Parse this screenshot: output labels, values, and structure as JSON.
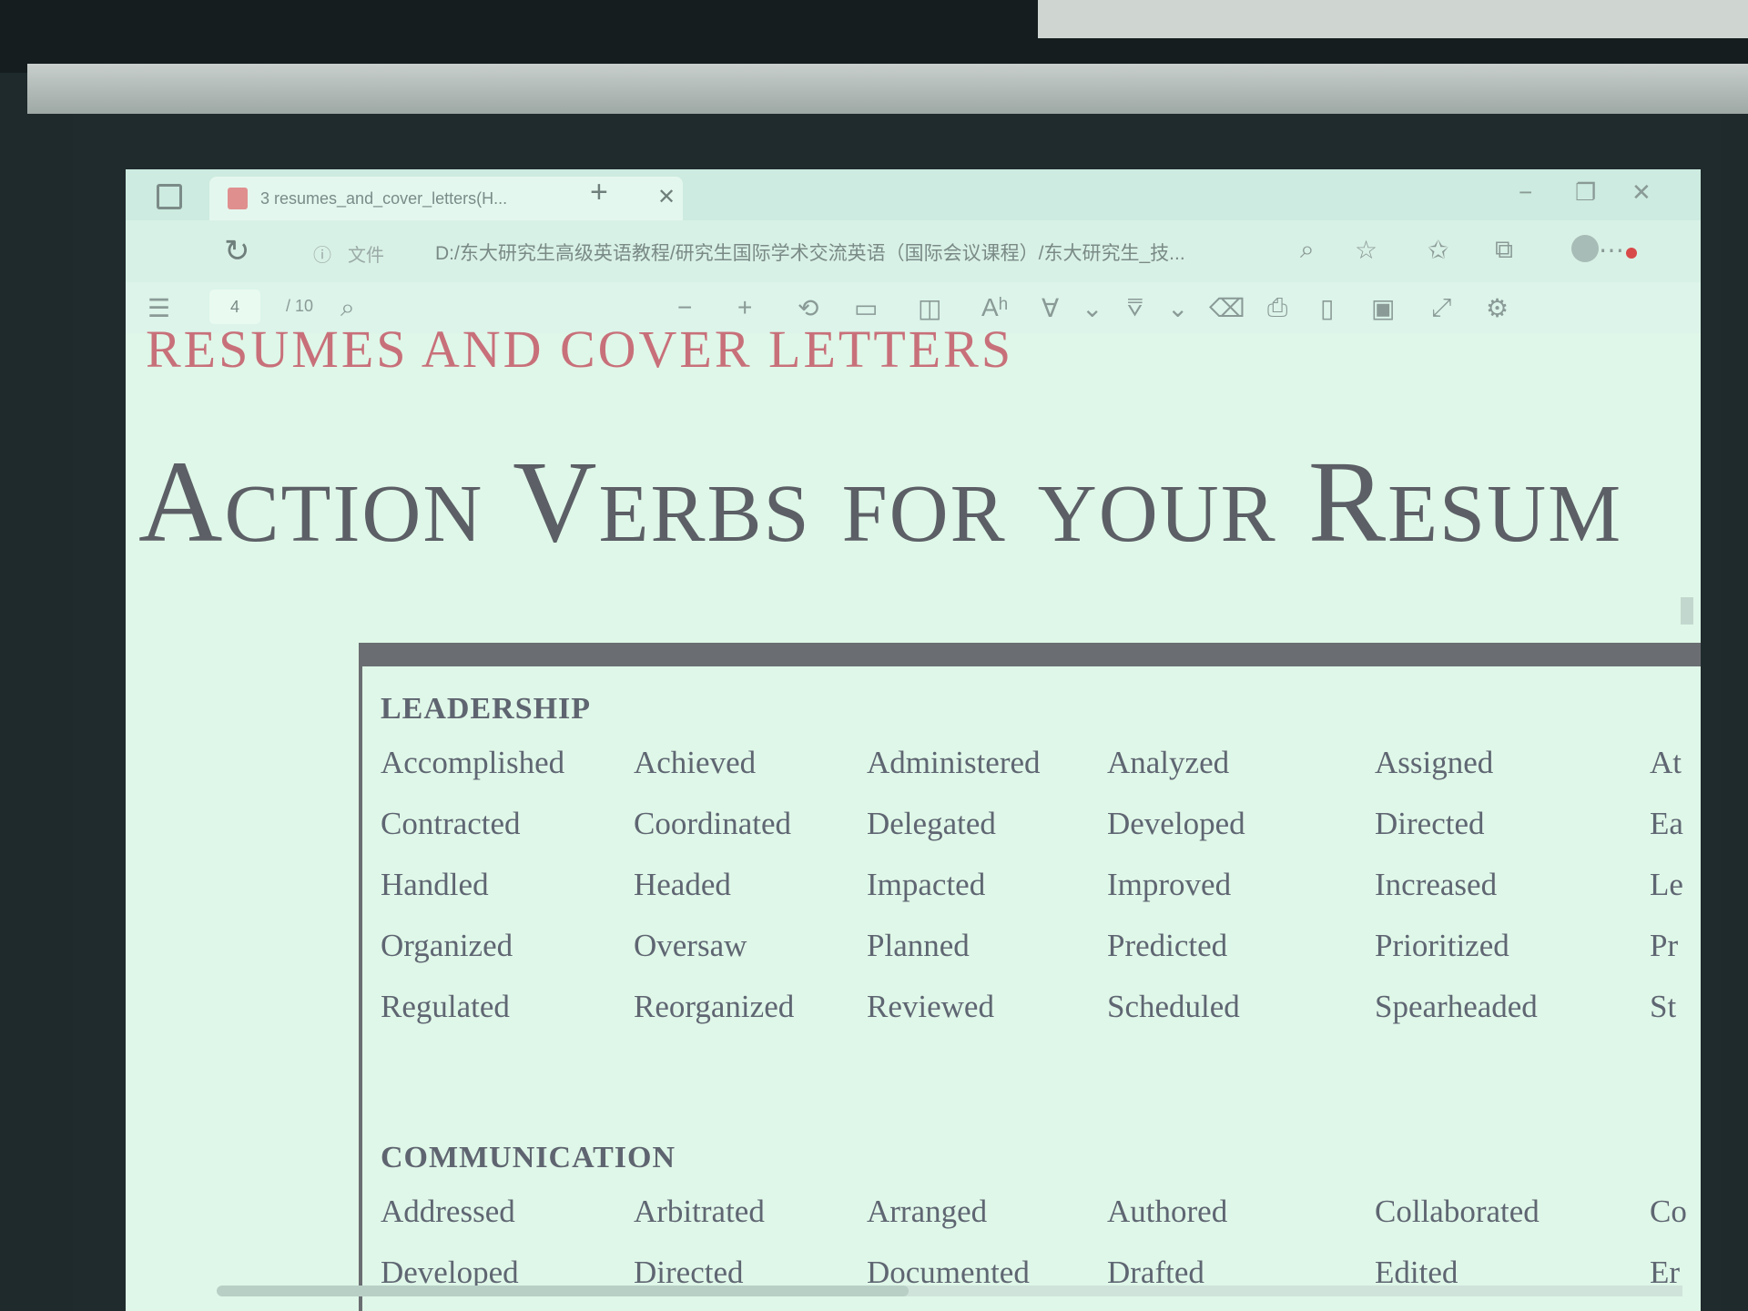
{
  "tab": {
    "title": "3 resumes_and_cover_letters(H...",
    "close_icon": "close-icon",
    "new_tab_icon": "plus-icon"
  },
  "window_controls": {
    "minimize": "−",
    "restore": "❐",
    "close": "✕"
  },
  "address": {
    "info_label": "文件",
    "url": "D:/东大研究生高级英语教程/研究生国际学术交流英语（国际会议课程）/东大研究生_技..."
  },
  "pdf_toolbar": {
    "page_current": "4",
    "page_total": "/ 10"
  },
  "document": {
    "header": "RESUMES AND COVER LETTERS",
    "title": "Action Verbs for your Resum",
    "sections": [
      {
        "heading": "LEADERSHIP",
        "rows": [
          [
            "Accomplished",
            "Achieved",
            "Administered",
            "Analyzed",
            "Assigned",
            "At"
          ],
          [
            "Contracted",
            "Coordinated",
            "Delegated",
            "Developed",
            "Directed",
            "Ea"
          ],
          [
            "Handled",
            "Headed",
            "Impacted",
            "Improved",
            "Increased",
            "Le"
          ],
          [
            "Organized",
            "Oversaw",
            "Planned",
            "Predicted",
            "Prioritized",
            "Pr"
          ],
          [
            "Regulated",
            "Reorganized",
            "Reviewed",
            "Scheduled",
            "Spearheaded",
            "St"
          ]
        ]
      },
      {
        "heading": "COMMUNICATION",
        "rows": [
          [
            "Addressed",
            "Arbitrated",
            "Arranged",
            "Authored",
            "Collaborated",
            "Co"
          ],
          [
            "Developed",
            "Directed",
            "Documented",
            "Drafted",
            "Edited",
            "Er"
          ]
        ]
      }
    ]
  }
}
